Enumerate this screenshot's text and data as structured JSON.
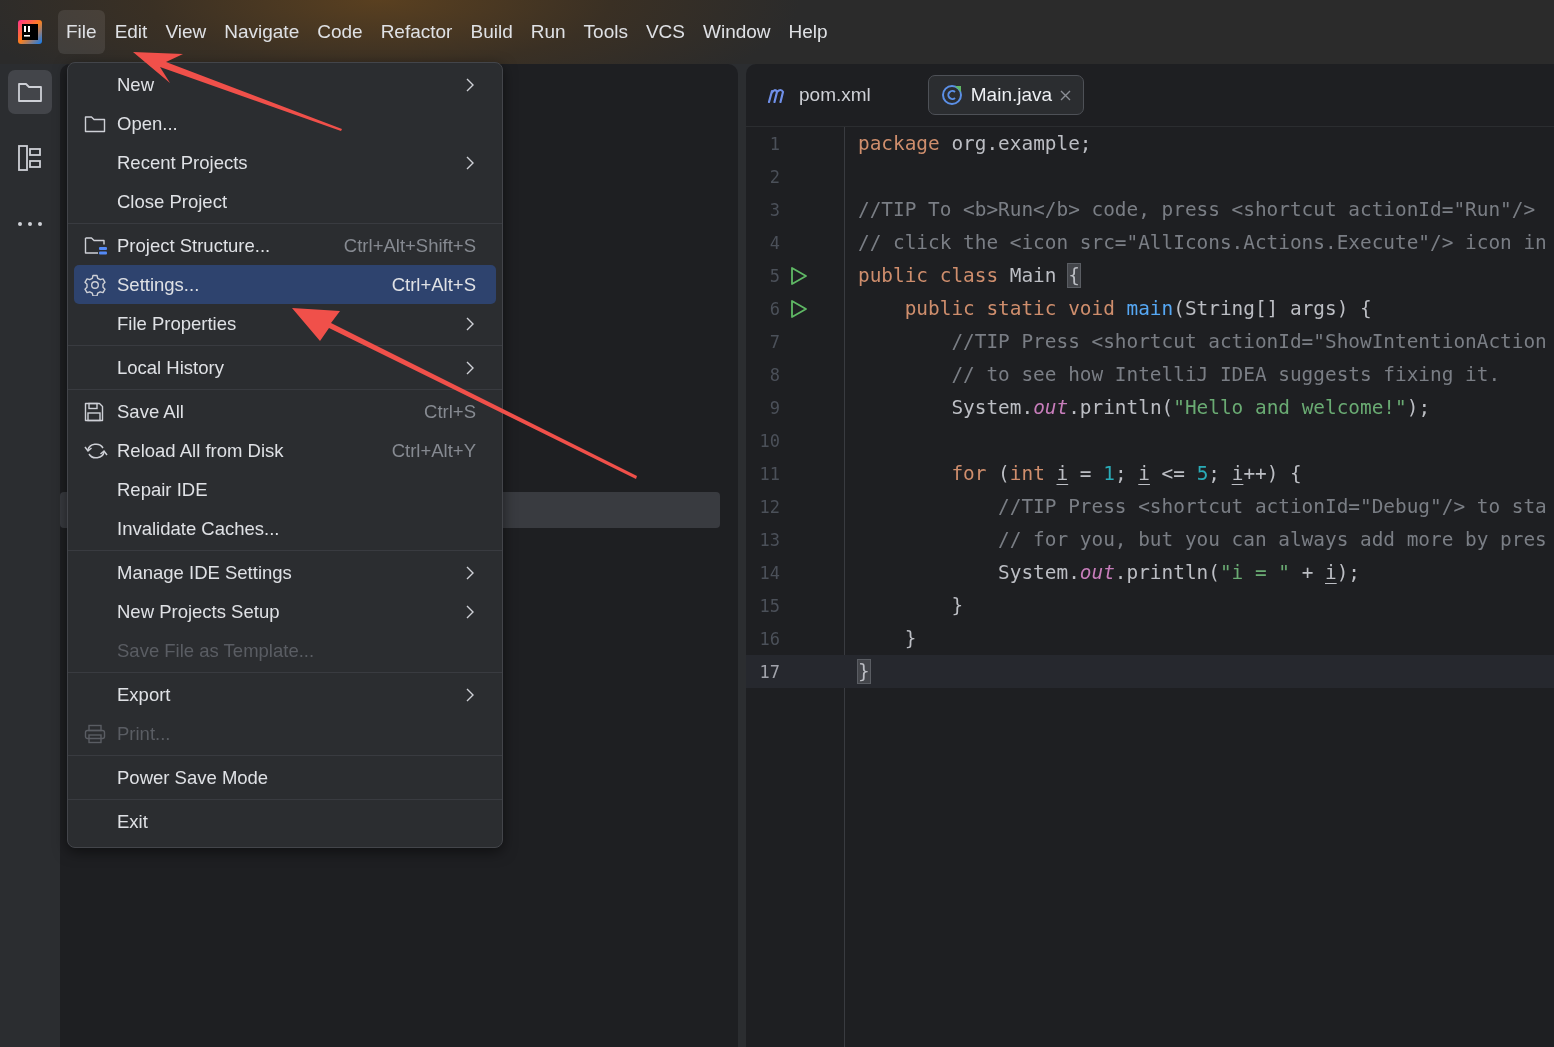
{
  "menu_bar": [
    {
      "label": "File",
      "selected": true
    },
    {
      "label": "Edit",
      "selected": false
    },
    {
      "label": "View",
      "selected": false
    },
    {
      "label": "Navigate",
      "selected": false
    },
    {
      "label": "Code",
      "selected": false
    },
    {
      "label": "Refactor",
      "selected": false
    },
    {
      "label": "Build",
      "selected": false
    },
    {
      "label": "Run",
      "selected": false
    },
    {
      "label": "Tools",
      "selected": false
    },
    {
      "label": "VCS",
      "selected": false
    },
    {
      "label": "Window",
      "selected": false
    },
    {
      "label": "Help",
      "selected": false
    }
  ],
  "sidebar": [
    {
      "kind": "project",
      "selected": true
    },
    {
      "kind": "structure",
      "selected": false
    },
    {
      "kind": "more",
      "selected": false
    }
  ],
  "file_menu": {
    "sections": [
      {
        "items": [
          {
            "label": "New",
            "submenu": true,
            "disabled": false,
            "selected": false
          },
          {
            "label": "Open...",
            "kind": "folder",
            "submenu": false,
            "disabled": false,
            "selected": false
          },
          {
            "label": "Recent Projects",
            "submenu": true,
            "disabled": false,
            "selected": false
          },
          {
            "label": "Close Project",
            "submenu": false,
            "disabled": false,
            "selected": false
          }
        ]
      },
      {
        "items": [
          {
            "label": "Project Structure...",
            "kind": "project-structure",
            "shortcut": "Ctrl+Alt+Shift+S",
            "submenu": false,
            "disabled": false,
            "selected": false
          },
          {
            "label": "Settings...",
            "kind": "settings",
            "shortcut": "Ctrl+Alt+S",
            "submenu": false,
            "disabled": false,
            "selected": true
          },
          {
            "label": "File Properties",
            "submenu": true,
            "disabled": false,
            "selected": false
          }
        ]
      },
      {
        "items": [
          {
            "label": "Local History",
            "submenu": true,
            "disabled": false,
            "selected": false
          }
        ]
      },
      {
        "items": [
          {
            "label": "Save All",
            "kind": "save",
            "shortcut": "Ctrl+S",
            "submenu": false,
            "disabled": false,
            "selected": false
          },
          {
            "label": "Reload All from Disk",
            "kind": "reload",
            "shortcut": "Ctrl+Alt+Y",
            "submenu": false,
            "disabled": false,
            "selected": false
          },
          {
            "label": "Repair IDE",
            "submenu": false,
            "disabled": false,
            "selected": false
          },
          {
            "label": "Invalidate Caches...",
            "submenu": false,
            "disabled": false,
            "selected": false
          }
        ]
      },
      {
        "items": [
          {
            "label": "Manage IDE Settings",
            "submenu": true,
            "disabled": false,
            "selected": false
          },
          {
            "label": "New Projects Setup",
            "submenu": true,
            "disabled": false,
            "selected": false
          },
          {
            "label": "Save File as Template...",
            "submenu": false,
            "disabled": true,
            "selected": false
          }
        ]
      },
      {
        "items": [
          {
            "label": "Export",
            "submenu": true,
            "disabled": false,
            "selected": false
          },
          {
            "label": "Print...",
            "kind": "print",
            "submenu": false,
            "disabled": true,
            "selected": false
          }
        ]
      },
      {
        "items": [
          {
            "label": "Power Save Mode",
            "submenu": false,
            "disabled": false,
            "selected": false
          }
        ]
      },
      {
        "items": [
          {
            "label": "Exit",
            "submenu": false,
            "disabled": false,
            "selected": false
          }
        ]
      }
    ]
  },
  "editor_tabs": [
    {
      "label": "pom.xml",
      "kind": "maven",
      "closable": false,
      "selected": false
    },
    {
      "label": "Main.java",
      "kind": "java",
      "closable": true,
      "selected": true
    }
  ],
  "code_lines": [
    {
      "number": "1",
      "run": false,
      "current": false,
      "tokens": [
        {
          "kind": "kw",
          "text": "package "
        },
        {
          "kind": "plain",
          "text": "org.example;"
        }
      ]
    },
    {
      "number": "2",
      "run": false,
      "current": false
    },
    {
      "number": "3",
      "run": false,
      "current": false,
      "tokens": [
        {
          "kind": "comment",
          "text": "//TIP To <b>Run</b> code, press <shortcut actionId=\"Run\"/>"
        }
      ]
    },
    {
      "number": "4",
      "run": false,
      "current": false,
      "tokens": [
        {
          "kind": "comment",
          "text": "// click the <icon src=\"AllIcons.Actions.Execute\"/> icon in"
        }
      ]
    },
    {
      "number": "5",
      "run": true,
      "current": false,
      "tokens": [
        {
          "kind": "kw",
          "text": "public class "
        },
        {
          "kind": "plain",
          "text": "Main "
        },
        {
          "kind": "brace_match",
          "text": "{"
        }
      ]
    },
    {
      "number": "6",
      "run": true,
      "current": false,
      "tokens": [
        {
          "kind": "kw",
          "text": "    public static void "
        },
        {
          "kind": "fn",
          "text": "main"
        },
        {
          "kind": "plain",
          "text": "(String[] args) {"
        }
      ]
    },
    {
      "number": "7",
      "run": false,
      "current": false,
      "tokens": [
        {
          "kind": "comment",
          "text": "        //TIP Press <shortcut actionId=\"ShowIntentionAction"
        }
      ]
    },
    {
      "number": "8",
      "run": false,
      "current": false,
      "tokens": [
        {
          "kind": "comment",
          "text": "        // to see how IntelliJ IDEA suggests fixing it."
        }
      ]
    },
    {
      "number": "9",
      "run": false,
      "current": false,
      "tokens": [
        {
          "kind": "plain",
          "text": "        System."
        },
        {
          "kind": "field",
          "text": "out"
        },
        {
          "kind": "plain",
          "text": ".println("
        },
        {
          "kind": "string",
          "text": "\"Hello and welcome!\""
        },
        {
          "kind": "plain",
          "text": ");"
        }
      ]
    },
    {
      "number": "10",
      "run": false,
      "current": false
    },
    {
      "number": "11",
      "run": false,
      "current": false,
      "tokens": [
        {
          "kind": "kw",
          "text": "        for "
        },
        {
          "kind": "plain",
          "text": "("
        },
        {
          "kind": "kw",
          "text": "int "
        },
        {
          "kind": "var",
          "text": "i"
        },
        {
          "kind": "plain",
          "text": " = "
        },
        {
          "kind": "num",
          "text": "1"
        },
        {
          "kind": "plain",
          "text": "; "
        },
        {
          "kind": "var",
          "text": "i"
        },
        {
          "kind": "plain",
          "text": " <= "
        },
        {
          "kind": "num",
          "text": "5"
        },
        {
          "kind": "plain",
          "text": "; "
        },
        {
          "kind": "var",
          "text": "i"
        },
        {
          "kind": "plain",
          "text": "++) {"
        }
      ]
    },
    {
      "number": "12",
      "run": false,
      "current": false,
      "tokens": [
        {
          "kind": "comment",
          "text": "            //TIP Press <shortcut actionId=\"Debug\"/> to sta"
        }
      ]
    },
    {
      "number": "13",
      "run": false,
      "current": false,
      "tokens": [
        {
          "kind": "comment",
          "text": "            // for you, but you can always add more by pres"
        }
      ]
    },
    {
      "number": "14",
      "run": false,
      "current": false,
      "tokens": [
        {
          "kind": "plain",
          "text": "            System."
        },
        {
          "kind": "field",
          "text": "out"
        },
        {
          "kind": "plain",
          "text": ".println("
        },
        {
          "kind": "string",
          "text": "\"i = \""
        },
        {
          "kind": "plain",
          "text": " + "
        },
        {
          "kind": "var",
          "text": "i"
        },
        {
          "kind": "plain",
          "text": ");"
        }
      ]
    },
    {
      "number": "15",
      "run": false,
      "current": false,
      "tokens": [
        {
          "kind": "plain",
          "text": "        }"
        }
      ]
    },
    {
      "number": "16",
      "run": false,
      "current": false,
      "tokens": [
        {
          "kind": "plain",
          "text": "    }"
        }
      ]
    },
    {
      "number": "17",
      "run": false,
      "current": true,
      "tokens": [
        {
          "kind": "brace_match",
          "text": "}"
        }
      ]
    }
  ]
}
